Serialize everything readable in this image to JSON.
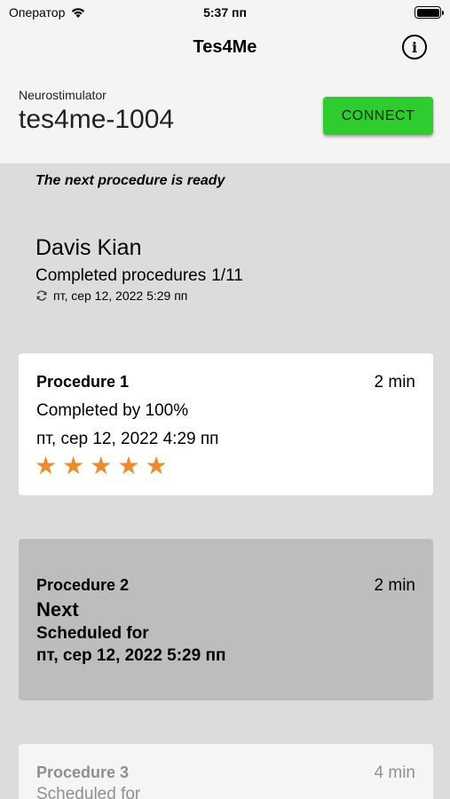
{
  "status_bar": {
    "carrier": "Оператор",
    "time": "5:37 пп",
    "wifi_icon": "wifi-icon",
    "battery_icon": "battery-icon"
  },
  "navbar": {
    "title": "Tes4Me",
    "info_icon": "info-icon",
    "info_glyph": "i"
  },
  "device": {
    "label": "Neurostimulator",
    "name": "tes4me-1004",
    "connect_label": "CONNECT",
    "connect_color": "#2ecc2e"
  },
  "banner": "The next procedure is ready",
  "patient": {
    "name": "Davis Kian",
    "completed_label": "Completed procedures",
    "completed_count": "1/11",
    "sync_icon": "sync-icon",
    "last_sync": "пт, сер 12, 2022 5:29 пп"
  },
  "procedures": [
    {
      "title": "Procedure 1",
      "duration": "2 min",
      "status": "Completed by 100%",
      "date": "пт, сер 12, 2022 4:29 пп",
      "rating": 5,
      "rating_max": 5,
      "star_color": "#ea8c2b"
    },
    {
      "title": "Procedure 2",
      "duration": "2 min",
      "badge": "Next",
      "scheduled_label": "Scheduled for",
      "date": "пт, сер 12, 2022 5:29 пп"
    },
    {
      "title": "Procedure 3",
      "duration": "4 min",
      "scheduled_label": "Scheduled for"
    }
  ]
}
